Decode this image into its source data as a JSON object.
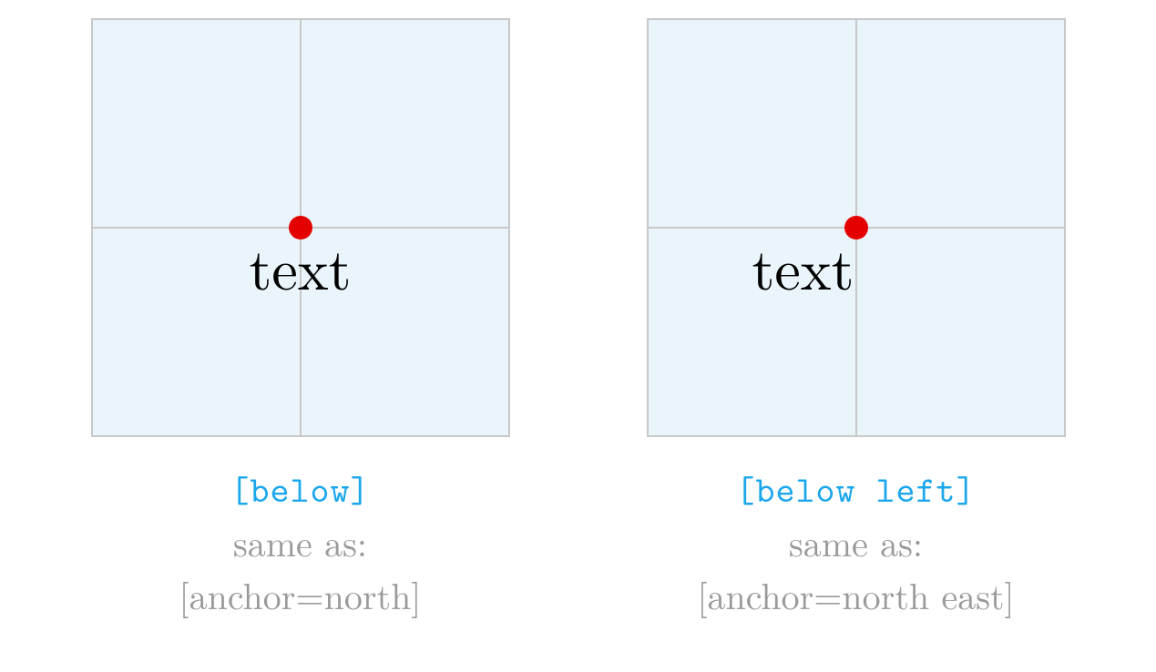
{
  "panels": [
    {
      "node_text": "text",
      "placement_class": "pos-below",
      "option_label": "[below]",
      "same_as_label": "same as:",
      "anchor_label": "[anchor=north]"
    },
    {
      "node_text": "text",
      "placement_class": "pos-below-left",
      "option_label": "[below left]",
      "same_as_label": "same as:",
      "anchor_label": "[anchor=north east]"
    }
  ],
  "colors": {
    "grid_bg": "#eaf4fb",
    "grid_line": "#c8c8c8",
    "dot": "#e50000",
    "code": "#1ca7ec",
    "note": "#9a9a9a"
  }
}
